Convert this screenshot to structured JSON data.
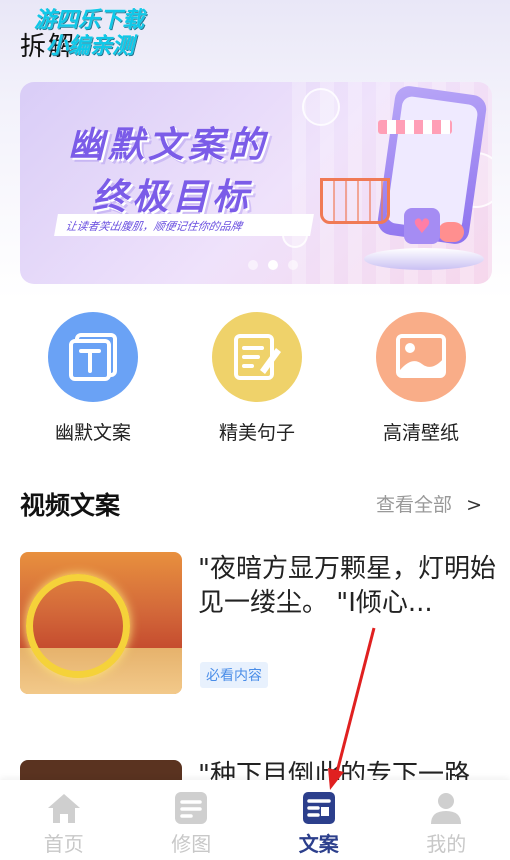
{
  "header": {
    "title": "拆解",
    "watermark_line1": "游四乐下载",
    "watermark_line2": "小编亲测"
  },
  "banner": {
    "line1": "幽默文案的",
    "line2": "终极目标",
    "subtitle": "让读者笑出腹肌，顺便记住你的品牌",
    "page_count": 3,
    "active_page": 2
  },
  "shortcuts": [
    {
      "label": "幽默文案",
      "icon": "text-doc-icon",
      "color": "#6aa2f5"
    },
    {
      "label": "精美句子",
      "icon": "edit-doc-icon",
      "color": "#efd26a"
    },
    {
      "label": "高清壁纸",
      "icon": "image-icon",
      "color": "#f9ad88"
    }
  ],
  "section": {
    "title": "视频文案",
    "view_all": "查看全部",
    "view_all_arrow": ">"
  },
  "cards": [
    {
      "text": "\"夜暗方显万颗星，灯明始见一缕尘。 \"I倾心...",
      "tag": "必看内容"
    },
    {
      "text": "\"种下目倒此的专下一路"
    }
  ],
  "tabbar": {
    "items": [
      {
        "label": "首页",
        "icon": "home-icon",
        "active": false
      },
      {
        "label": "修图",
        "icon": "edit-image-icon",
        "active": false
      },
      {
        "label": "文案",
        "icon": "copywriting-icon",
        "active": true
      },
      {
        "label": "我的",
        "icon": "user-icon",
        "active": false
      }
    ]
  },
  "colors": {
    "accent": "#2c3f8c",
    "annotation_arrow": "#e02020"
  }
}
